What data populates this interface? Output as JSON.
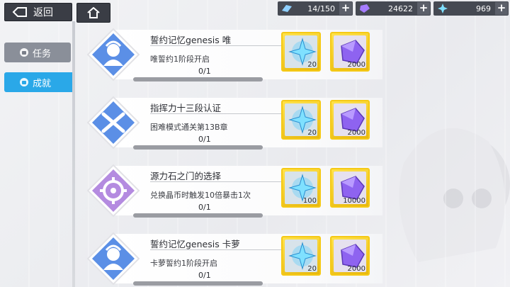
{
  "topbar": {
    "back_label": "返回",
    "resources": [
      {
        "icon": "stamina-icon",
        "value": "14/150"
      },
      {
        "icon": "crystal-icon",
        "value": "24622"
      },
      {
        "icon": "star-shard-icon",
        "value": "969"
      }
    ],
    "plus": "+"
  },
  "nav": {
    "task_label": "任务",
    "achievement_label": "成就"
  },
  "achievements": [
    {
      "title": "誓约记忆genesis 唯",
      "desc": "唯誓约1阶段开启",
      "progress": "0/1",
      "progress_fraction": 0,
      "badge": "heroine-icon",
      "badge_color": "#5b8fe6",
      "rewards": [
        "20",
        "2000"
      ]
    },
    {
      "title": "指挥力十三段认证",
      "desc": "困难模式通关第13B章",
      "progress": "0/1",
      "progress_fraction": 0,
      "badge": "crossed-guns-icon",
      "badge_color": "#5b8fe6",
      "rewards": [
        "20",
        "2000"
      ]
    },
    {
      "title": "源力石之门的选择",
      "desc": "兑换晶币时触发10倍暴击1次",
      "progress": "0/1",
      "progress_fraction": 0,
      "badge": "gear-icon",
      "badge_color": "#b48be0",
      "rewards": [
        "100",
        "10000"
      ]
    },
    {
      "title": "誓约记忆genesis 卡萝",
      "desc": "卡萝誓约1阶段开启",
      "progress": "0/1",
      "progress_fraction": 0,
      "badge": "heroine-icon",
      "badge_color": "#5b8fe6",
      "rewards": [
        "20",
        "2000"
      ]
    }
  ]
}
